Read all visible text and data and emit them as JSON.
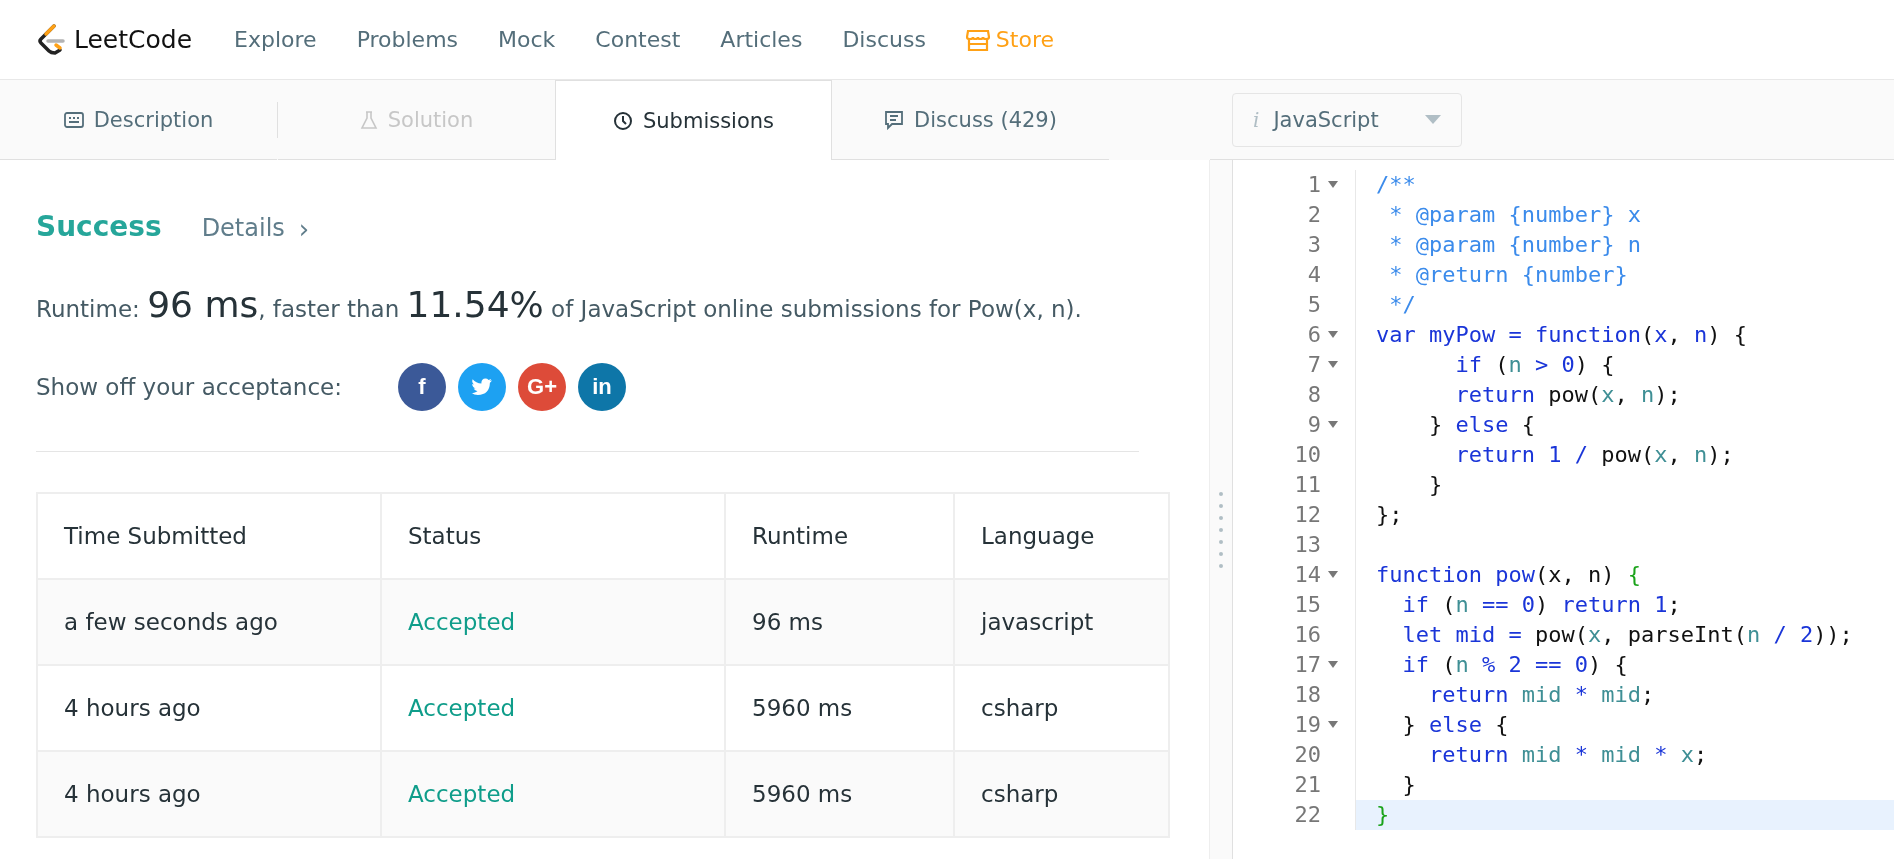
{
  "brand": {
    "name": "LeetCode"
  },
  "nav": [
    {
      "label": "Explore",
      "kind": "link"
    },
    {
      "label": "Problems",
      "kind": "link"
    },
    {
      "label": "Mock",
      "kind": "link"
    },
    {
      "label": "Contest",
      "kind": "link"
    },
    {
      "label": "Articles",
      "kind": "link"
    },
    {
      "label": "Discuss",
      "kind": "link"
    },
    {
      "label": "Store",
      "kind": "store"
    }
  ],
  "tabs": [
    {
      "label": "Description",
      "selected": false,
      "disabled": false
    },
    {
      "label": "Solution",
      "selected": false,
      "disabled": true
    },
    {
      "label": "Submissions",
      "selected": true,
      "disabled": false
    },
    {
      "label": "Discuss (429)",
      "selected": false,
      "disabled": false
    }
  ],
  "language_select": {
    "value": "JavaScript",
    "info": "i"
  },
  "result": {
    "status": "Success",
    "details": "Details",
    "details_arrow": "›"
  },
  "summary": {
    "parts": [
      {
        "text": "Runtime: ",
        "big": false
      },
      {
        "text": "96 ms",
        "big": true
      },
      {
        "text": ", faster than ",
        "big": false
      },
      {
        "text": "11.54%",
        "big": true
      },
      {
        "text": " of JavaScript online submissions for Pow(x, n).",
        "big": false
      }
    ]
  },
  "share": {
    "label": "Show off your acceptance:",
    "buttons": [
      {
        "text": "f",
        "color": "#3b5998"
      },
      {
        "color": "#1da1f2"
      },
      {
        "text": "G+",
        "color": "#dd4b39"
      },
      {
        "text": "in",
        "color": "#0e76a8"
      }
    ]
  },
  "table": {
    "columns": [
      "Time Submitted",
      "Status",
      "Runtime",
      "Language"
    ],
    "rows": [
      [
        "a few seconds ago",
        "Accepted",
        "96 ms",
        "javascript"
      ],
      [
        "4 hours ago",
        "Accepted",
        "5960 ms",
        "csharp"
      ],
      [
        "4 hours ago",
        "Accepted",
        "5960 ms",
        "csharp"
      ]
    ]
  },
  "code": {
    "lines": [
      {
        "number": "1",
        "foldable": true,
        "active": false,
        "tokens": [
          {
            "text": "/**",
            "kind": "comment"
          }
        ]
      },
      {
        "number": "2",
        "foldable": false,
        "active": false,
        "tokens": [
          {
            "text": " * @param {number} x",
            "kind": "comment"
          }
        ]
      },
      {
        "number": "3",
        "foldable": false,
        "active": false,
        "tokens": [
          {
            "text": " * @param {number} n",
            "kind": "comment"
          }
        ]
      },
      {
        "number": "4",
        "foldable": false,
        "active": false,
        "tokens": [
          {
            "text": " * @return {number}",
            "kind": "comment"
          }
        ]
      },
      {
        "number": "5",
        "foldable": false,
        "active": false,
        "tokens": [
          {
            "text": " */",
            "kind": "comment"
          }
        ]
      },
      {
        "number": "6",
        "foldable": true,
        "active": false,
        "tokens": [
          {
            "text": "var myPow = function",
            "kind": "keyword"
          },
          {
            "text": "(",
            "kind": "plain"
          },
          {
            "text": "x",
            "kind": "keyword"
          },
          {
            "text": ", ",
            "kind": "plain"
          },
          {
            "text": "n",
            "kind": "keyword"
          },
          {
            "text": ") {",
            "kind": "plain"
          }
        ]
      },
      {
        "number": "7",
        "foldable": true,
        "active": false,
        "tokens": [
          {
            "text": "      if",
            "kind": "keyword"
          },
          {
            "text": " (",
            "kind": "plain"
          },
          {
            "text": "n",
            "kind": "variable"
          },
          {
            "text": " > 0",
            "kind": "keyword"
          },
          {
            "text": ") {",
            "kind": "plain"
          }
        ]
      },
      {
        "number": "8",
        "foldable": false,
        "active": false,
        "tokens": [
          {
            "text": "      return",
            "kind": "keyword"
          },
          {
            "text": " pow(",
            "kind": "plain"
          },
          {
            "text": "x",
            "kind": "variable"
          },
          {
            "text": ", ",
            "kind": "plain"
          },
          {
            "text": "n",
            "kind": "variable"
          },
          {
            "text": ");",
            "kind": "plain"
          }
        ]
      },
      {
        "number": "9",
        "foldable": true,
        "active": false,
        "tokens": [
          {
            "text": "    } ",
            "kind": "plain"
          },
          {
            "text": "else",
            "kind": "keyword"
          },
          {
            "text": " {",
            "kind": "plain"
          }
        ]
      },
      {
        "number": "10",
        "foldable": false,
        "active": false,
        "tokens": [
          {
            "text": "      return 1 /",
            "kind": "keyword"
          },
          {
            "text": " pow(",
            "kind": "plain"
          },
          {
            "text": "x",
            "kind": "variable"
          },
          {
            "text": ", ",
            "kind": "plain"
          },
          {
            "text": "n",
            "kind": "variable"
          },
          {
            "text": ");",
            "kind": "plain"
          }
        ]
      },
      {
        "number": "11",
        "foldable": false,
        "active": false,
        "tokens": [
          {
            "text": "    }",
            "kind": "plain"
          }
        ]
      },
      {
        "number": "12",
        "foldable": false,
        "active": false,
        "tokens": [
          {
            "text": "};",
            "kind": "plain"
          }
        ]
      },
      {
        "number": "13",
        "foldable": false,
        "active": false
      },
      {
        "number": "14",
        "foldable": true,
        "active": false,
        "tokens": [
          {
            "text": "function pow",
            "kind": "keyword"
          },
          {
            "text": "(x, n) ",
            "kind": "plain"
          },
          {
            "text": "{",
            "kind": "match"
          }
        ]
      },
      {
        "number": "15",
        "foldable": false,
        "active": false,
        "tokens": [
          {
            "text": "  if",
            "kind": "keyword"
          },
          {
            "text": " (",
            "kind": "plain"
          },
          {
            "text": "n",
            "kind": "variable"
          },
          {
            "text": " == 0",
            "kind": "keyword"
          },
          {
            "text": ") ",
            "kind": "plain"
          },
          {
            "text": "return 1",
            "kind": "keyword"
          },
          {
            "text": ";",
            "kind": "plain"
          }
        ]
      },
      {
        "number": "16",
        "foldable": false,
        "active": false,
        "tokens": [
          {
            "text": "  let mid =",
            "kind": "keyword"
          },
          {
            "text": " pow(",
            "kind": "plain"
          },
          {
            "text": "x",
            "kind": "variable"
          },
          {
            "text": ", parseInt(",
            "kind": "plain"
          },
          {
            "text": "n",
            "kind": "variable"
          },
          {
            "text": " / 2",
            "kind": "keyword"
          },
          {
            "text": "));",
            "kind": "plain"
          }
        ]
      },
      {
        "number": "17",
        "foldable": true,
        "active": false,
        "tokens": [
          {
            "text": "  if",
            "kind": "keyword"
          },
          {
            "text": " (",
            "kind": "plain"
          },
          {
            "text": "n",
            "kind": "variable"
          },
          {
            "text": " % 2 == 0",
            "kind": "keyword"
          },
          {
            "text": ") {",
            "kind": "plain"
          }
        ]
      },
      {
        "number": "18",
        "foldable": false,
        "active": false,
        "tokens": [
          {
            "text": "    return ",
            "kind": "keyword"
          },
          {
            "text": "mid",
            "kind": "variable"
          },
          {
            "text": " * ",
            "kind": "keyword"
          },
          {
            "text": "mid",
            "kind": "variable"
          },
          {
            "text": ";",
            "kind": "plain"
          }
        ]
      },
      {
        "number": "19",
        "foldable": true,
        "active": false,
        "tokens": [
          {
            "text": "  } ",
            "kind": "plain"
          },
          {
            "text": "else",
            "kind": "keyword"
          },
          {
            "text": " {",
            "kind": "plain"
          }
        ]
      },
      {
        "number": "20",
        "foldable": false,
        "active": false,
        "tokens": [
          {
            "text": "    return ",
            "kind": "keyword"
          },
          {
            "text": "mid",
            "kind": "variable"
          },
          {
            "text": " * ",
            "kind": "keyword"
          },
          {
            "text": "mid",
            "kind": "variable"
          },
          {
            "text": " * ",
            "kind": "keyword"
          },
          {
            "text": "x",
            "kind": "variable"
          },
          {
            "text": ";",
            "kind": "plain"
          }
        ]
      },
      {
        "number": "21",
        "foldable": false,
        "active": false,
        "tokens": [
          {
            "text": "  }",
            "kind": "plain"
          }
        ]
      },
      {
        "number": "22",
        "foldable": false,
        "active": true,
        "tokens": [
          {
            "text": "}",
            "kind": "match"
          }
        ]
      }
    ]
  }
}
